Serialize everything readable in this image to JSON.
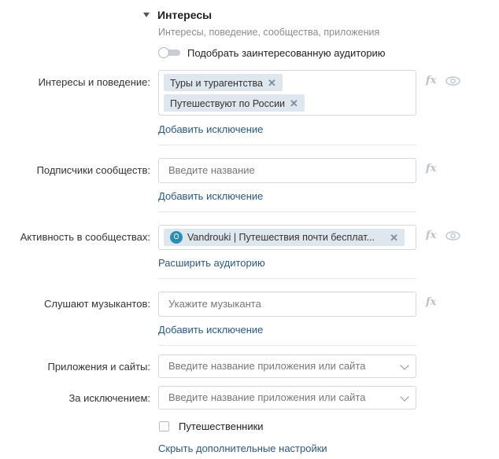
{
  "section": {
    "title": "Интересы",
    "subtitle": "Интересы, поведение, сообщества, приложения",
    "toggle_label": "Подобрать заинтересованную аудиторию",
    "toggle_on": false
  },
  "interests": {
    "label": "Интересы и поведение:",
    "tags": [
      "Туры и турагентства",
      "Путешествуют по России"
    ],
    "link": "Добавить исключение",
    "fx": "fx"
  },
  "subscribers": {
    "label": "Подписчики сообществ:",
    "placeholder": "Введите название",
    "link": "Добавить исключение",
    "fx": "fx"
  },
  "activity": {
    "label": "Активность в сообществах:",
    "tag": "Vandrouki | Путешествия почти бесплат...",
    "link": "Расширить аудиторию",
    "fx": "fx"
  },
  "music": {
    "label": "Слушают музыкантов:",
    "placeholder": "Укажите музыканта",
    "link": "Добавить исключение",
    "fx": "fx"
  },
  "apps": {
    "label": "Приложения и сайты:",
    "placeholder": "Введите название приложения или сайта"
  },
  "except": {
    "label": "За исключением:",
    "placeholder": "Введите название приложения или сайта"
  },
  "travelers": {
    "label": "Путешественники",
    "checked": false
  },
  "hide_link": "Скрыть дополнительные настройки",
  "colors": {
    "link": "#2a5885",
    "tag_bg": "#dee6ee",
    "border": "#d3d9de"
  },
  "icons": [
    "caret-down-icon",
    "close-icon",
    "fx-icon",
    "eye-icon",
    "chevron-down-icon",
    "community-avatar-icon"
  ]
}
